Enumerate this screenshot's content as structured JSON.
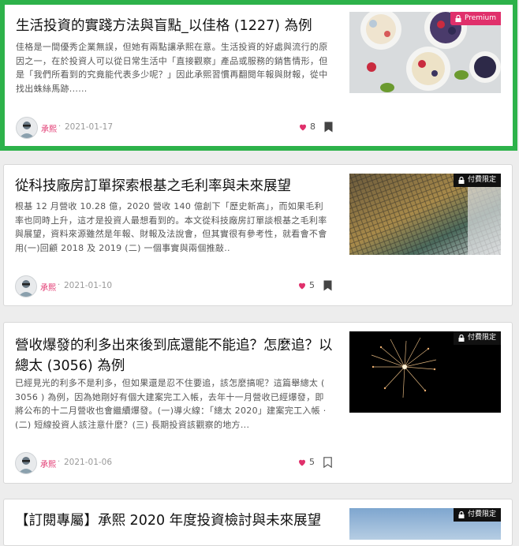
{
  "colors": {
    "selected_border": "#2db24a",
    "author": "#e0306b",
    "heart": "#e0306b"
  },
  "articles": [
    {
      "title": "生活投資的實踐方法與盲點_以佳格 (1227) 為例",
      "excerpt": "佳格是一間優秀企業無誤，但她有兩點讓承熙在意。生活投資的好處與流行的原因之一，在於投資人可以從日常生活中「直接觀察」產品或服務的銷售情形，但是「我們所看到的究竟能代表多少呢？」因此承熙習慣再翻閱年報與財報，從中找出蛛絲馬跡......",
      "author": "承熙",
      "date": "2021-01-17",
      "likes": "8",
      "badge": "Premium",
      "bookmarked": true
    },
    {
      "title": "從科技廠房訂單探索根基之毛利率與未來展望",
      "excerpt": "根基 12 月營收 10.28 億，2020 營收 140 億創下「歷史新高」，而如果毛利率也同時上升，這才是投資人最想看到的。本文從科技廠房訂單談根基之毛利率與展望，資料來源雖然是年報、財報及法說會，但其實很有參考性，就看會不會用(一)回顧 2018 及 2019 (二) 一個事實與兩個推敲..",
      "author": "承熙",
      "date": "2021-01-10",
      "likes": "5",
      "badge": "付費限定",
      "bookmarked": true
    },
    {
      "title": "營收爆發的利多出來後到底還能不能追？怎麼追？以總太 (3056) 為例",
      "excerpt": "已經見光的利多不是利多，但如果還是忍不住要追，該怎麼搞呢？這篇舉總太 ( 3056 ) 為例，因為她剛好有個大建案完工入帳，去年十一月營收已經爆發，即將公布的十二月營收也會繼續爆發。(一)導火線：「總太 2020」建案完工入帳 · (二) 短線投資人該注意什麼？(三) 長期投資該觀察的地方...",
      "author": "承熙",
      "date": "2021-01-06",
      "likes": "5",
      "badge": "付費限定",
      "bookmarked": false
    },
    {
      "title": "【訂閱專屬】承熙 2020 年度投資檢討與未來展望",
      "badge": "付費限定"
    }
  ]
}
